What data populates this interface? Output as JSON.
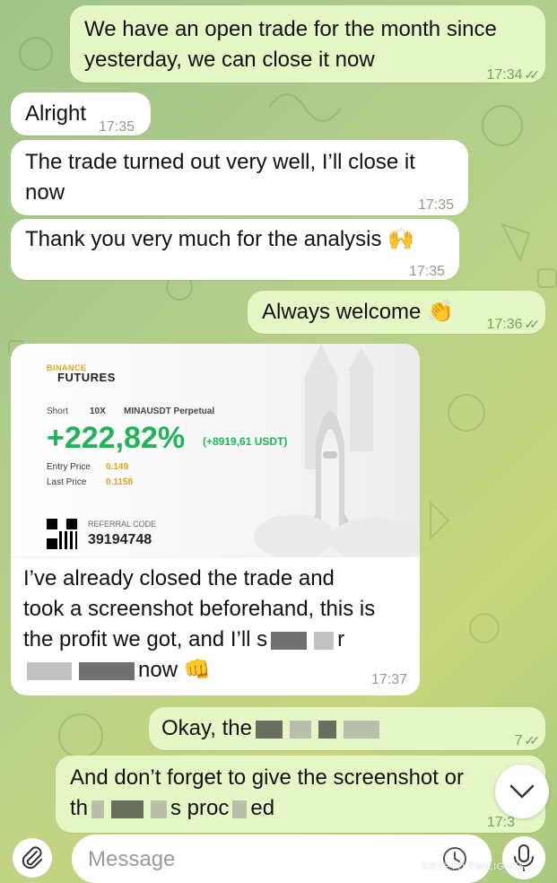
{
  "messages": [
    {
      "text_1": "We have an open trade for the month since",
      "text_2": "yesterday, we can close it now",
      "time": "17:34"
    },
    {
      "text": "Alright",
      "time": "17:35"
    },
    {
      "text_1": "The trade turned out very well, I’ll close it",
      "text_2": "now",
      "time": "17:35"
    },
    {
      "text": "Thank you very much for the analysis",
      "emoji": "🙌",
      "time": "17:35"
    },
    {
      "text": "Always welcome",
      "emoji": "👏",
      "time": "17:36"
    },
    {
      "caption_1": "I’ve already closed the trade and",
      "caption_2": "took a screenshot beforehand, this is",
      "caption_3": "the profit we got, and I’ll s",
      "caption_3b": "r",
      "caption_4": "now",
      "emoji": "👊",
      "time": "17:37"
    },
    {
      "text": "Okay, the",
      "time": "7"
    },
    {
      "text_1": "And don’t forget to give the screenshot or",
      "text_2a": "th",
      "text_2b": "s proc",
      "text_2c": "ed",
      "time": "17:3"
    }
  ],
  "trade_card": {
    "brand_small": "BINANCE",
    "brand": "FUTURES",
    "side": "Short",
    "leverage": "10X",
    "pair": "MINAUSDT Perpetual",
    "pnl_percent": "+222,82%",
    "pnl_usdt": "(+8919,61 USDT)",
    "entry_label": "Entry Price",
    "entry_value": "0.149",
    "last_label": "Last Price",
    "last_value": "0.1158",
    "referral_label": "REFERRAL CODE",
    "referral_code": "39194748"
  },
  "input": {
    "placeholder": "Message"
  },
  "watermark": "CRYPTO TWILIGHTS",
  "icons": {
    "attach": "paperclip-icon",
    "sticker": "sticker-clock-icon",
    "mic": "microphone-icon",
    "scroll": "chevron-down-icon"
  }
}
